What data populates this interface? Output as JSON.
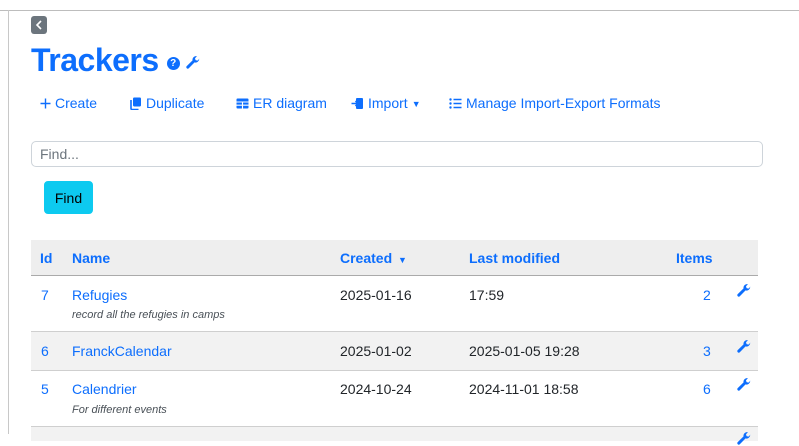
{
  "page": {
    "title": "Trackers",
    "help_icon_glyph": "?"
  },
  "toolbar": {
    "create_label": "Create",
    "duplicate_label": "Duplicate",
    "er_diagram_label": "ER diagram",
    "import_label": "Import",
    "manage_formats_label": "Manage Import-Export Formats"
  },
  "search": {
    "placeholder": "Find...",
    "value": "",
    "button_label": "Find"
  },
  "table": {
    "headers": {
      "id": "Id",
      "name": "Name",
      "created": "Created",
      "last_modified": "Last modified",
      "items": "Items"
    },
    "rows": [
      {
        "id": "7",
        "name": "Refugies",
        "description": "record all the refugies in camps",
        "created": "2025-01-16",
        "last_modified": "17:59",
        "items": "2"
      },
      {
        "id": "6",
        "name": "FranckCalendar",
        "description": "",
        "created": "2025-01-02",
        "last_modified": "2025-01-05 19:28",
        "items": "3"
      },
      {
        "id": "5",
        "name": "Calendrier",
        "description": "For different events",
        "created": "2024-10-24",
        "last_modified": "2024-11-01 18:58",
        "items": "6"
      }
    ]
  },
  "colors": {
    "accent": "#0d6efd",
    "find_button": "#0dcaf0",
    "header_bg": "#eeeeee",
    "alt_row_bg": "#f2f2f2"
  },
  "icons": {
    "back": "chevron-left-icon",
    "help": "question-circle-icon",
    "settings": "wrench-icon",
    "create": "plus-icon",
    "duplicate": "copy-icon",
    "er_diagram": "table-icon",
    "import": "import-icon",
    "manage_formats": "list-icon",
    "sort": "caret-down-icon"
  }
}
